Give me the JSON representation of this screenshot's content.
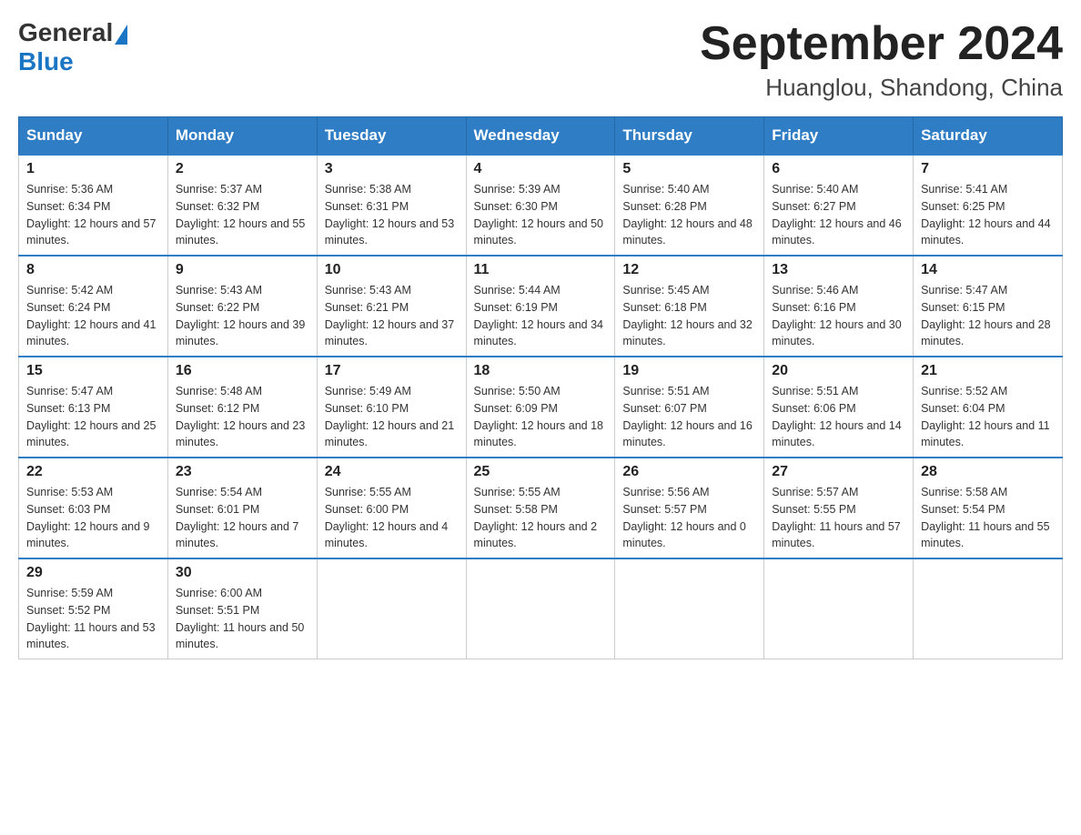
{
  "header": {
    "logo_general": "General",
    "logo_blue": "Blue",
    "title": "September 2024",
    "subtitle": "Huanglou, Shandong, China"
  },
  "weekdays": [
    "Sunday",
    "Monday",
    "Tuesday",
    "Wednesday",
    "Thursday",
    "Friday",
    "Saturday"
  ],
  "weeks": [
    [
      {
        "day": "1",
        "sunrise": "5:36 AM",
        "sunset": "6:34 PM",
        "daylight": "12 hours and 57 minutes."
      },
      {
        "day": "2",
        "sunrise": "5:37 AM",
        "sunset": "6:32 PM",
        "daylight": "12 hours and 55 minutes."
      },
      {
        "day": "3",
        "sunrise": "5:38 AM",
        "sunset": "6:31 PM",
        "daylight": "12 hours and 53 minutes."
      },
      {
        "day": "4",
        "sunrise": "5:39 AM",
        "sunset": "6:30 PM",
        "daylight": "12 hours and 50 minutes."
      },
      {
        "day": "5",
        "sunrise": "5:40 AM",
        "sunset": "6:28 PM",
        "daylight": "12 hours and 48 minutes."
      },
      {
        "day": "6",
        "sunrise": "5:40 AM",
        "sunset": "6:27 PM",
        "daylight": "12 hours and 46 minutes."
      },
      {
        "day": "7",
        "sunrise": "5:41 AM",
        "sunset": "6:25 PM",
        "daylight": "12 hours and 44 minutes."
      }
    ],
    [
      {
        "day": "8",
        "sunrise": "5:42 AM",
        "sunset": "6:24 PM",
        "daylight": "12 hours and 41 minutes."
      },
      {
        "day": "9",
        "sunrise": "5:43 AM",
        "sunset": "6:22 PM",
        "daylight": "12 hours and 39 minutes."
      },
      {
        "day": "10",
        "sunrise": "5:43 AM",
        "sunset": "6:21 PM",
        "daylight": "12 hours and 37 minutes."
      },
      {
        "day": "11",
        "sunrise": "5:44 AM",
        "sunset": "6:19 PM",
        "daylight": "12 hours and 34 minutes."
      },
      {
        "day": "12",
        "sunrise": "5:45 AM",
        "sunset": "6:18 PM",
        "daylight": "12 hours and 32 minutes."
      },
      {
        "day": "13",
        "sunrise": "5:46 AM",
        "sunset": "6:16 PM",
        "daylight": "12 hours and 30 minutes."
      },
      {
        "day": "14",
        "sunrise": "5:47 AM",
        "sunset": "6:15 PM",
        "daylight": "12 hours and 28 minutes."
      }
    ],
    [
      {
        "day": "15",
        "sunrise": "5:47 AM",
        "sunset": "6:13 PM",
        "daylight": "12 hours and 25 minutes."
      },
      {
        "day": "16",
        "sunrise": "5:48 AM",
        "sunset": "6:12 PM",
        "daylight": "12 hours and 23 minutes."
      },
      {
        "day": "17",
        "sunrise": "5:49 AM",
        "sunset": "6:10 PM",
        "daylight": "12 hours and 21 minutes."
      },
      {
        "day": "18",
        "sunrise": "5:50 AM",
        "sunset": "6:09 PM",
        "daylight": "12 hours and 18 minutes."
      },
      {
        "day": "19",
        "sunrise": "5:51 AM",
        "sunset": "6:07 PM",
        "daylight": "12 hours and 16 minutes."
      },
      {
        "day": "20",
        "sunrise": "5:51 AM",
        "sunset": "6:06 PM",
        "daylight": "12 hours and 14 minutes."
      },
      {
        "day": "21",
        "sunrise": "5:52 AM",
        "sunset": "6:04 PM",
        "daylight": "12 hours and 11 minutes."
      }
    ],
    [
      {
        "day": "22",
        "sunrise": "5:53 AM",
        "sunset": "6:03 PM",
        "daylight": "12 hours and 9 minutes."
      },
      {
        "day": "23",
        "sunrise": "5:54 AM",
        "sunset": "6:01 PM",
        "daylight": "12 hours and 7 minutes."
      },
      {
        "day": "24",
        "sunrise": "5:55 AM",
        "sunset": "6:00 PM",
        "daylight": "12 hours and 4 minutes."
      },
      {
        "day": "25",
        "sunrise": "5:55 AM",
        "sunset": "5:58 PM",
        "daylight": "12 hours and 2 minutes."
      },
      {
        "day": "26",
        "sunrise": "5:56 AM",
        "sunset": "5:57 PM",
        "daylight": "12 hours and 0 minutes."
      },
      {
        "day": "27",
        "sunrise": "5:57 AM",
        "sunset": "5:55 PM",
        "daylight": "11 hours and 57 minutes."
      },
      {
        "day": "28",
        "sunrise": "5:58 AM",
        "sunset": "5:54 PM",
        "daylight": "11 hours and 55 minutes."
      }
    ],
    [
      {
        "day": "29",
        "sunrise": "5:59 AM",
        "sunset": "5:52 PM",
        "daylight": "11 hours and 53 minutes."
      },
      {
        "day": "30",
        "sunrise": "6:00 AM",
        "sunset": "5:51 PM",
        "daylight": "11 hours and 50 minutes."
      },
      null,
      null,
      null,
      null,
      null
    ]
  ],
  "labels": {
    "sunrise": "Sunrise:",
    "sunset": "Sunset:",
    "daylight": "Daylight:"
  }
}
